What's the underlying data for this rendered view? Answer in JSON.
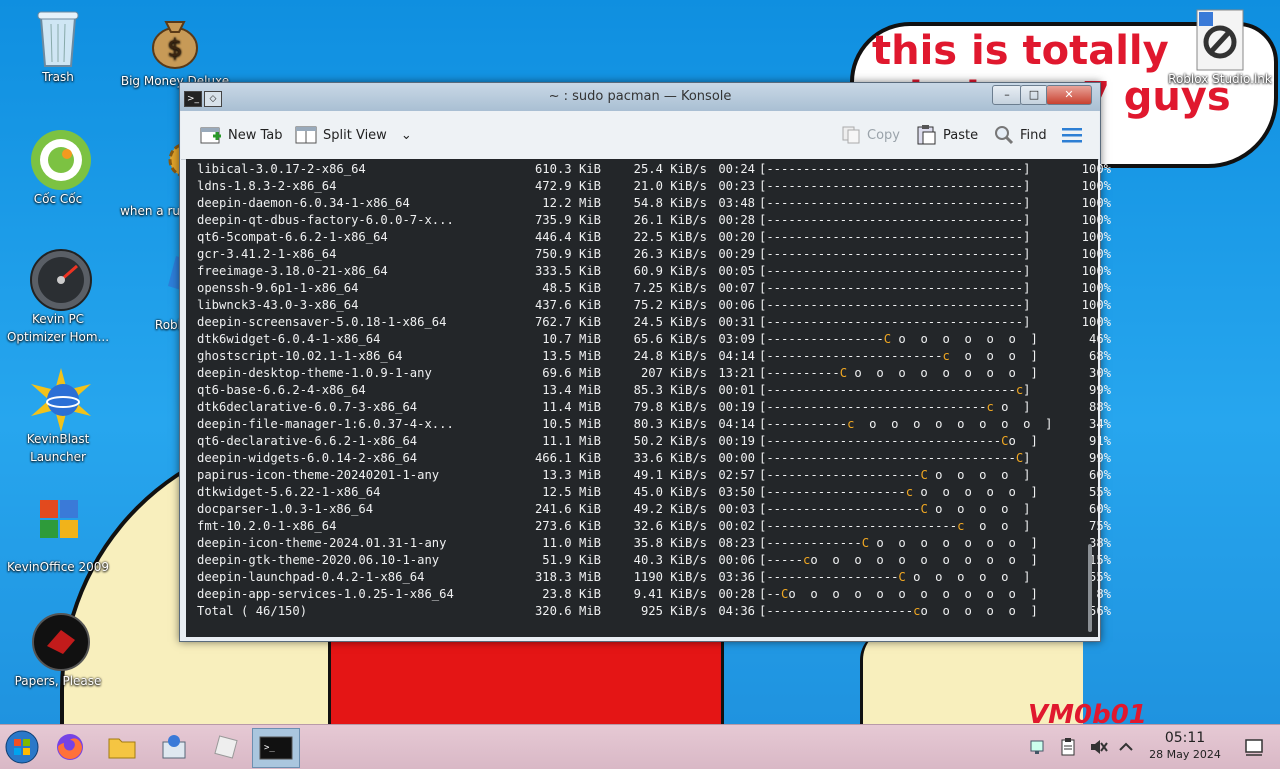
{
  "desktop": {
    "cloud_line1": "this is totally",
    "cloud_line2": "windows 7 guys",
    "signature": "VM0b01",
    "icons": [
      {
        "label": "Trash"
      },
      {
        "label": "Big Money Deluxe"
      },
      {
        "label": "Cốc Cốc"
      },
      {
        "label": "when a russian r..."
      },
      {
        "label": "Kevin PC Optimizer Hom..."
      },
      {
        "label": "Roblox"
      },
      {
        "label": "KevinBlast Launcher"
      },
      {
        "label": "KevinOffice 2009"
      },
      {
        "label": "Papers, Please"
      },
      {
        "label": "Roblox Studio.lnk"
      }
    ]
  },
  "window": {
    "title": "~ : sudo pacman — Konsole",
    "toolbar": {
      "new_tab": "New Tab",
      "split_view": "Split View",
      "copy": "Copy",
      "paste": "Paste",
      "find": "Find"
    }
  },
  "terminal": {
    "lines": [
      {
        "pkg": "libical-3.0.17-2-x86_64",
        "size": "610.3 KiB",
        "rate": "25.4 KiB/s",
        "eta": "00:24",
        "bar": "[-----------------------------------]",
        "pct": "100%"
      },
      {
        "pkg": "ldns-1.8.3-2-x86_64",
        "size": "472.9 KiB",
        "rate": "21.0 KiB/s",
        "eta": "00:23",
        "bar": "[-----------------------------------]",
        "pct": "100%"
      },
      {
        "pkg": "deepin-daemon-6.0.34-1-x86_64",
        "size": "12.2 MiB",
        "rate": "54.8 KiB/s",
        "eta": "03:48",
        "bar": "[-----------------------------------]",
        "pct": "100%"
      },
      {
        "pkg": "deepin-qt-dbus-factory-6.0.0-7-x...",
        "size": "735.9 KiB",
        "rate": "26.1 KiB/s",
        "eta": "00:28",
        "bar": "[-----------------------------------]",
        "pct": "100%"
      },
      {
        "pkg": "qt6-5compat-6.6.2-1-x86_64",
        "size": "446.4 KiB",
        "rate": "22.5 KiB/s",
        "eta": "00:20",
        "bar": "[-----------------------------------]",
        "pct": "100%"
      },
      {
        "pkg": "gcr-3.41.2-1-x86_64",
        "size": "750.9 KiB",
        "rate": "26.3 KiB/s",
        "eta": "00:29",
        "bar": "[-----------------------------------]",
        "pct": "100%"
      },
      {
        "pkg": "freeimage-3.18.0-21-x86_64",
        "size": "333.5 KiB",
        "rate": "60.9 KiB/s",
        "eta": "00:05",
        "bar": "[-----------------------------------]",
        "pct": "100%"
      },
      {
        "pkg": "openssh-9.6p1-1-x86_64",
        "size": "48.5 KiB",
        "rate": "7.25 KiB/s",
        "eta": "00:07",
        "bar": "[-----------------------------------]",
        "pct": "100%"
      },
      {
        "pkg": "libwnck3-43.0-3-x86_64",
        "size": "437.6 KiB",
        "rate": "75.2 KiB/s",
        "eta": "00:06",
        "bar": "[-----------------------------------]",
        "pct": "100%"
      },
      {
        "pkg": "deepin-screensaver-5.0.18-1-x86_64",
        "size": "762.7 KiB",
        "rate": "24.5 KiB/s",
        "eta": "00:31",
        "bar": "[-----------------------------------]",
        "pct": "100%"
      },
      {
        "pkg": "dtk6widget-6.0.4-1-x86_64",
        "size": "10.7 MiB",
        "rate": "65.6 KiB/s",
        "eta": "03:09",
        "bar_pre": "[----------------",
        "pac": "C",
        "bar_post": " o  o  o  o  o  o  ]",
        "pct": "46%"
      },
      {
        "pkg": "ghostscript-10.02.1-1-x86_64",
        "size": "13.5 MiB",
        "rate": "24.8 KiB/s",
        "eta": "04:14",
        "bar_pre": "[------------------------",
        "pac": "c",
        "bar_post": "  o  o  o  ]",
        "pct": "68%"
      },
      {
        "pkg": "deepin-desktop-theme-1.0.9-1-any",
        "size": "69.6 MiB",
        "rate": "207 KiB/s",
        "eta": "13:21",
        "bar_pre": "[----------",
        "pac": "C",
        "bar_post": " o  o  o  o  o  o  o  o  ]",
        "pct": "30%"
      },
      {
        "pkg": "qt6-base-6.6.2-4-x86_64",
        "size": "13.4 MiB",
        "rate": "85.3 KiB/s",
        "eta": "00:01",
        "bar_pre": "[----------------------------------",
        "pac": "c",
        "bar_post": "]",
        "pct": "99%"
      },
      {
        "pkg": "dtk6declarative-6.0.7-3-x86_64",
        "size": "11.4 MiB",
        "rate": "79.8 KiB/s",
        "eta": "00:19",
        "bar_pre": "[------------------------------",
        "pac": "c",
        "bar_post": " o  ]",
        "pct": "88%"
      },
      {
        "pkg": "deepin-file-manager-1:6.0.37-4-x...",
        "size": "10.5 MiB",
        "rate": "80.3 KiB/s",
        "eta": "04:14",
        "bar_pre": "[-----------",
        "pac": "c",
        "bar_post": "  o  o  o  o  o  o  o  o  ]",
        "pct": "34%"
      },
      {
        "pkg": "qt6-declarative-6.6.2-1-x86_64",
        "size": "11.1 MiB",
        "rate": "50.2 KiB/s",
        "eta": "00:19",
        "bar_pre": "[--------------------------------",
        "pac": "C",
        "bar_post": "o  ]",
        "pct": "91%"
      },
      {
        "pkg": "deepin-widgets-6.0.14-2-x86_64",
        "size": "466.1 KiB",
        "rate": "33.6 KiB/s",
        "eta": "00:00",
        "bar_pre": "[----------------------------------",
        "pac": "C",
        "bar_post": "]",
        "pct": "99%"
      },
      {
        "pkg": "papirus-icon-theme-20240201-1-any",
        "size": "13.3 MiB",
        "rate": "49.1 KiB/s",
        "eta": "02:57",
        "bar_pre": "[---------------------",
        "pac": "C",
        "bar_post": " o  o  o  o  ]",
        "pct": "60%"
      },
      {
        "pkg": "dtkwidget-5.6.22-1-x86_64",
        "size": "12.5 MiB",
        "rate": "45.0 KiB/s",
        "eta": "03:50",
        "bar_pre": "[-------------------",
        "pac": "c",
        "bar_post": " o  o  o  o  o  ]",
        "pct": "55%"
      },
      {
        "pkg": "docparser-1.0.3-1-x86_64",
        "size": "241.6 KiB",
        "rate": "49.2 KiB/s",
        "eta": "00:03",
        "bar_pre": "[---------------------",
        "pac": "C",
        "bar_post": " o  o  o  o  ]",
        "pct": "60%"
      },
      {
        "pkg": "fmt-10.2.0-1-x86_64",
        "size": "273.6 KiB",
        "rate": "32.6 KiB/s",
        "eta": "00:02",
        "bar_pre": "[--------------------------",
        "pac": "c",
        "bar_post": "  o  o  ]",
        "pct": "75%"
      },
      {
        "pkg": "deepin-icon-theme-2024.01.31-1-any",
        "size": "11.0 MiB",
        "rate": "35.8 KiB/s",
        "eta": "08:23",
        "bar_pre": "[-------------",
        "pac": "C",
        "bar_post": " o  o  o  o  o  o  o  ]",
        "pct": "38%"
      },
      {
        "pkg": "deepin-gtk-theme-2020.06.10-1-any",
        "size": "51.9 KiB",
        "rate": "40.3 KiB/s",
        "eta": "00:06",
        "bar_pre": "[-----",
        "pac": "c",
        "bar_post": "o  o  o  o  o  o  o  o  o  o  ]",
        "pct": "15%"
      },
      {
        "pkg": "deepin-launchpad-0.4.2-1-x86_64",
        "size": "318.3 MiB",
        "rate": "1190 KiB/s",
        "eta": "03:36",
        "bar_pre": "[------------------",
        "pac": "C",
        "bar_post": " o  o  o  o  o  ]",
        "pct": "55%"
      },
      {
        "pkg": "deepin-app-services-1.0.25-1-x86_64",
        "size": "23.8 KiB",
        "rate": "9.41 KiB/s",
        "eta": "00:28",
        "bar_pre": "[--",
        "pac": "C",
        "bar_post": "o  o  o  o  o  o  o  o  o  o  o  ]",
        "pct": "8%"
      },
      {
        "pkg": "Total ( 46/150)",
        "size": "320.6 MiB",
        "rate": "925 KiB/s",
        "eta": "04:36",
        "bar_pre": "[--------------------",
        "pac": "c",
        "bar_post": "o  o  o  o  o  ]",
        "pct": "56%"
      }
    ]
  },
  "taskbar": {
    "clock_time": "05:11",
    "clock_date": "28 May 2024"
  }
}
